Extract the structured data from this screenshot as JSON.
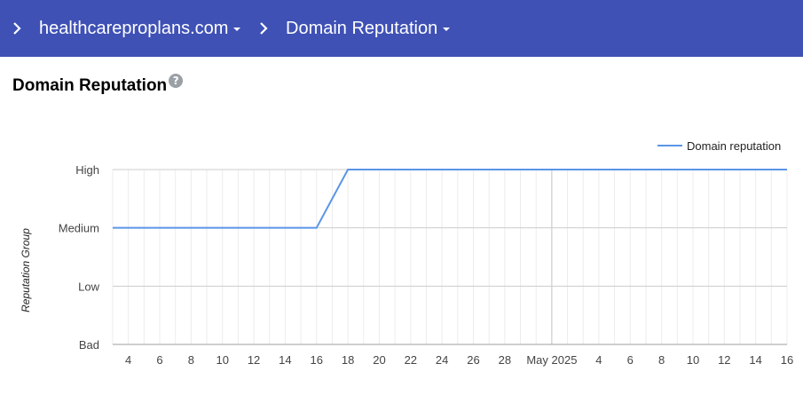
{
  "header": {
    "domain": "healthcareproplans.com",
    "section": "Domain Reputation",
    "color": "#3f51b5"
  },
  "page": {
    "title": "Domain Reputation",
    "help_icon": "help-icon"
  },
  "chart_data": {
    "type": "line",
    "title": "",
    "ylabel": "Reputation Group",
    "xlabel": "",
    "y_categories": [
      "Bad",
      "Low",
      "Medium",
      "High"
    ],
    "x_tick_labels": [
      "4",
      "6",
      "8",
      "10",
      "12",
      "14",
      "16",
      "18",
      "20",
      "22",
      "24",
      "26",
      "28",
      "May 2025",
      "4",
      "6",
      "8",
      "10",
      "12",
      "14",
      "16"
    ],
    "x_range": [
      "2025-04-03",
      "2025-05-16"
    ],
    "series": [
      {
        "name": "Domain reputation",
        "color": "#5b95e8",
        "points": [
          {
            "x": "2025-04-03",
            "y": "Medium"
          },
          {
            "x": "2025-04-16",
            "y": "Medium"
          },
          {
            "x": "2025-04-18",
            "y": "High"
          },
          {
            "x": "2025-05-16",
            "y": "High"
          }
        ]
      }
    ],
    "legend": "top-right",
    "grid": true
  }
}
